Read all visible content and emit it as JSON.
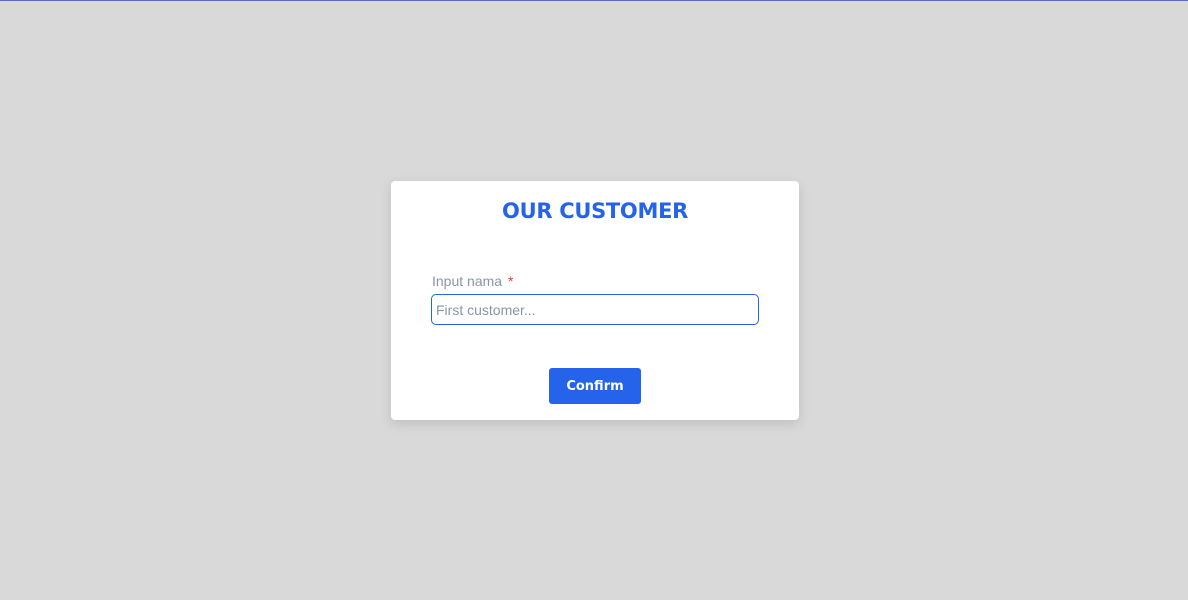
{
  "card": {
    "title": "OUR CUSTOMER"
  },
  "form": {
    "name_field": {
      "label": "Input nama",
      "required_marker": "*",
      "value": "",
      "placeholder": "First customer..."
    },
    "confirm_label": "Confirm"
  },
  "colors": {
    "accent": "#2563eb",
    "background": "#d9d9d9",
    "required": "#e53935"
  }
}
